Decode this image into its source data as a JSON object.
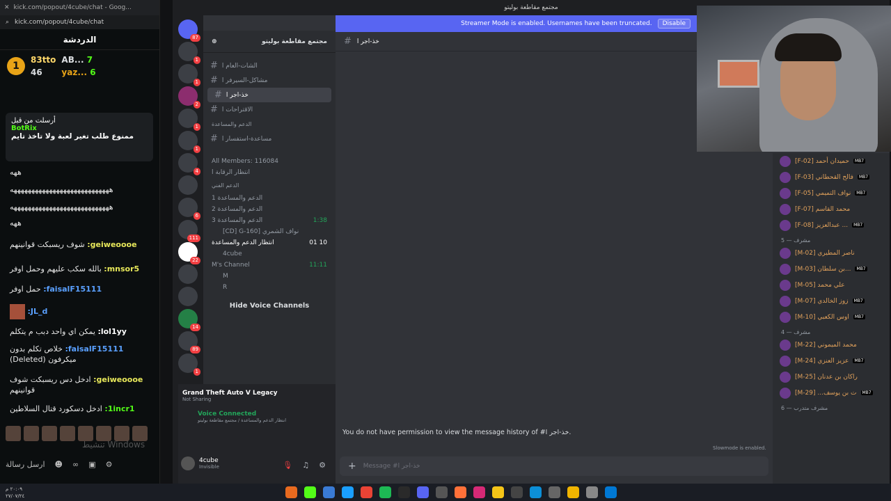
{
  "kick": {
    "url_title": "kick.com/popout/4cube/chat - Goog...",
    "url": "kick.com/popout/4cube/chat",
    "chat_title": "الدردشة",
    "leaderboard": {
      "first_name": "83tto",
      "first_count": "46",
      "second_name": "AB...",
      "second_count": "7",
      "third_name": "yaz...",
      "third_count": "6"
    },
    "pinned": {
      "header": "أرسلت من قبل",
      "bot": "BotRix",
      "text": "ممنوع طلب تغير لعبة ولا تاخذ تايم"
    },
    "messages": [
      {
        "user": "",
        "text": "ههه"
      },
      {
        "user": "",
        "text": "ههههههههههههههههههههههههههههه"
      },
      {
        "user": "",
        "text": "ههههههههههههههههههههههههههههه"
      },
      {
        "user": "",
        "text": "ههه"
      },
      {
        "user": "geiweoooe:",
        "text": "شوف ريسبكت قوانينهم"
      },
      {
        "user": "mnsor5:",
        "text": "بالله سكب عليهم وحمل اوفر"
      },
      {
        "user": "faisalF15111:",
        "text": "حمل اوفر"
      },
      {
        "user": "JL_d:",
        "text": ""
      },
      {
        "user": "lol1yy:",
        "text": "يمكن اي واحد دبب م يتكلم"
      },
      {
        "user": "faisalF15111:",
        "text": "خلاص تكلم بدون ميكرفون (Deleted)"
      },
      {
        "user": "geiweoooe:",
        "text": "ادخل دس ريسبكت شوف قوانينهم"
      },
      {
        "user": "1incr1:",
        "text": "ادخل دسكورد قتال السلاطين"
      }
    ],
    "watermark": "تنشيط Windows",
    "send_label": "ارسل رسالة"
  },
  "discord": {
    "window_title": "مجتمع مقاطعة بوليتو",
    "server_name": "مجتمع مقاطعة بوليتو",
    "streamer_banner": "Streamer Mode is enabled. Usernames have been truncated.",
    "disable_label": "Disable",
    "channels": [
      {
        "name": "الشات-العام ا",
        "active": false
      },
      {
        "name": "مشاكل-السيرفر ا",
        "active": false
      },
      {
        "name": "خذ-اجر ا",
        "active": true
      },
      {
        "name": "الاقتراحات ا",
        "active": false
      }
    ],
    "support_category": "الدعم والمساعدة",
    "help_channel": "مساعدة-استفسار ا",
    "voice": [
      {
        "name": "All Members: 116084",
        "time": ""
      },
      {
        "name": "انتظار الرقابة ا",
        "time": ""
      },
      {
        "name": "الدعم الفني",
        "time": ""
      },
      {
        "name": "الدعم والمساعدة 1",
        "time": ""
      },
      {
        "name": "الدعم والمساعدة 2",
        "time": ""
      },
      {
        "name": "الدعم والمساعدة 3",
        "time": "1:38"
      },
      {
        "name": "[CD] G-160] نواف الشمري",
        "time": ""
      },
      {
        "name": "انتظار الدعم والمساعدة",
        "time": "01 10"
      },
      {
        "name": "4cube",
        "time": ""
      },
      {
        "name": "M's Channel",
        "time": "11:11"
      },
      {
        "name": "M",
        "time": ""
      },
      {
        "name": "R",
        "time": ""
      }
    ],
    "hide_voice": "Hide Voice Channels",
    "activity": {
      "game": "Grand Theft Auto V Legacy",
      "status": "Not Sharing"
    },
    "voice_connected": "Voice Connected",
    "voice_path": "انتظار الدعم والمساعدة / مجتمع مقاطعة بوليتو",
    "user": {
      "name": "4cube",
      "status": "Invisible"
    },
    "channel_header": "خذ-اجر ا",
    "no_permission": "You do not have permission to view the message history of #خذ-اجر ا.",
    "slowmode": "Slowmode is enabled.",
    "composer_placeholder": "Message #خذ-اجر ا",
    "members": [
      {
        "name": "[F-02] حميدان أحمد",
        "tag": "MB7"
      },
      {
        "name": "[F-03] فالح القحطاني",
        "tag": "MB7"
      },
      {
        "name": "[F-05] نواف التميمي",
        "tag": "MB7"
      },
      {
        "name": "[F-07] محمد القاسم",
        "tag": ""
      },
      {
        "name": "[F-08] عبدالعزيز ...",
        "tag": "MB7"
      },
      {
        "cat": "مشرف — 5"
      },
      {
        "name": "[M-02] ناصر المطيري",
        "tag": ""
      },
      {
        "name": "[M-03] بن سلطان...",
        "tag": "MB7"
      },
      {
        "name": "[M-05] علي محمد",
        "tag": ""
      },
      {
        "name": "[M-07] زوز الخالدي",
        "tag": "MB7"
      },
      {
        "name": "[M-10] اوس الكعبي",
        "tag": "MB7"
      },
      {
        "cat": "مشرف — 4"
      },
      {
        "name": "[M-22] محمد الميموني",
        "tag": ""
      },
      {
        "name": "[M-24] عزيز العنزي",
        "tag": "MB7"
      },
      {
        "name": "[M-25] راكان بن عدنان",
        "tag": ""
      },
      {
        "name": "[M-29] ...ت بن يوسف",
        "tag": "MB7"
      },
      {
        "cat": "مشرف متدرب — 6"
      }
    ]
  },
  "taskbar": {
    "clock": "٢٠:٠٩ م",
    "date": "٢٧/٠٧/٢٤"
  }
}
